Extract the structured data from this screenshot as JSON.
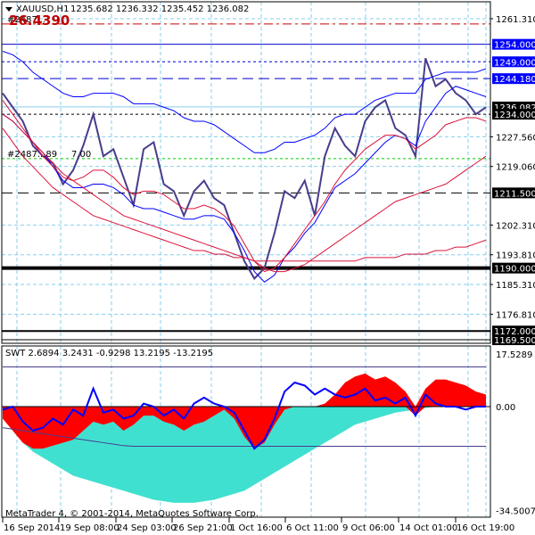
{
  "header": {
    "symbol": "XAUUSD,H1",
    "ohlc": "1235.682 1236.332 1235.452 1236.082",
    "object_label": "#2487...",
    "big_value": "26.4390",
    "obj_label2": "#2487...89",
    "obj_label2_value": "7.00"
  },
  "footer": {
    "copyright": "MetaTrader 4, © 2001-2014, MetaQuotes Software Corp."
  },
  "colors": {
    "price": "#483D8B",
    "band": "#0000FF",
    "ma": "#DC143C",
    "grid": "#87CEEB",
    "osc_pos": "#FF0000",
    "osc_neg": "#40E0D0",
    "osc_line": "#0000FF"
  },
  "chart_data": [
    {
      "type": "line",
      "title": "XAUUSD,H1",
      "ylim": [
        1166.8,
        1266
      ],
      "y_ticks": [
        "1261.310",
        "1227.560",
        "1219.060",
        "1202.310",
        "1193.810",
        "1185.310",
        "1176.810"
      ],
      "x_ticks": [
        "16 Sep 2014",
        "19 Sep 08:00",
        "24 Sep 03:00",
        "26 Sep 21:00",
        "1 Oct 16:00",
        "6 Oct 11:00",
        "9 Oct 06:00",
        "14 Oct 01:00",
        "16 Oct 19:00"
      ],
      "levels": [
        {
          "label": "1254.000",
          "value": 1254,
          "style": "solid",
          "color": "#0000CC",
          "box": "#0000FF"
        },
        {
          "label": "1249.000",
          "value": 1249,
          "style": "dash",
          "color": "#0000CC",
          "box": "#0000FF"
        },
        {
          "label": "1244.180",
          "value": 1244.18,
          "style": "longdash",
          "color": "#0000CC",
          "box": "#0000FF"
        },
        {
          "label": "1236.082",
          "value": 1236.082,
          "style": "bid",
          "color": "#87CEEB",
          "box": "#000000"
        },
        {
          "label": "1234.000",
          "value": 1234,
          "style": "dash",
          "color": "#000000",
          "box": "#000000"
        },
        {
          "label": "1211.500",
          "value": 1211.5,
          "style": "longdash",
          "color": "#000000",
          "box": "#000000"
        },
        {
          "label": "1190.000",
          "value": 1190,
          "style": "thick",
          "color": "#000000",
          "box": "#000000"
        },
        {
          "label": "1172.000",
          "value": 1172,
          "style": "medium",
          "color": "#000000",
          "box": "#000000"
        },
        {
          "label": "1169.500",
          "value": 1169.5,
          "style": "solid",
          "color": "#000000",
          "box": "#000000"
        },
        {
          "label": "",
          "value": 1259.8,
          "style": "dashdot",
          "color": "#CC0000",
          "box": ""
        },
        {
          "label": "",
          "value": 1221.3,
          "style": "dash",
          "color": "#00CC00",
          "box": ""
        }
      ],
      "series": [
        {
          "name": "close",
          "color": "#483D8B",
          "values": [
            1240,
            1236,
            1232,
            1225,
            1222,
            1220,
            1214,
            1218,
            1225,
            1234,
            1222,
            1224,
            1216,
            1208,
            1224,
            1226,
            1214,
            1212,
            1205,
            1212,
            1215,
            1210,
            1208,
            1200,
            1192,
            1187,
            1190,
            1200,
            1212,
            1210,
            1215,
            1205,
            1222,
            1230,
            1225,
            1222,
            1232,
            1236,
            1238,
            1230,
            1228,
            1222,
            1250,
            1242,
            1244,
            1240,
            1238,
            1234,
            1236
          ]
        },
        {
          "name": "upper-band",
          "color": "#0000FF",
          "values": [
            1252,
            1251,
            1249,
            1246,
            1244,
            1242,
            1240,
            1239,
            1239,
            1240,
            1240,
            1240,
            1239,
            1237,
            1237,
            1237,
            1236,
            1235,
            1233,
            1232,
            1232,
            1231,
            1229,
            1227,
            1225,
            1223,
            1223,
            1224,
            1226,
            1226,
            1227,
            1228,
            1230,
            1233,
            1234,
            1234,
            1236,
            1238,
            1239,
            1240,
            1240,
            1240,
            1244,
            1245,
            1246,
            1246,
            1246,
            1246,
            1247
          ]
        },
        {
          "name": "lower-band",
          "color": "#0000FF",
          "values": [
            1234,
            1232,
            1229,
            1226,
            1223,
            1219,
            1215,
            1213,
            1213,
            1214,
            1214,
            1213,
            1211,
            1208,
            1207,
            1207,
            1206,
            1205,
            1204,
            1204,
            1205,
            1205,
            1204,
            1200,
            1195,
            1189,
            1186,
            1188,
            1193,
            1196,
            1200,
            1203,
            1208,
            1213,
            1215,
            1217,
            1220,
            1223,
            1226,
            1228,
            1227,
            1225,
            1232,
            1236,
            1240,
            1242,
            1241,
            1240,
            1239
          ]
        },
        {
          "name": "ma-fast",
          "color": "#DC143C",
          "values": [
            1238,
            1234,
            1230,
            1226,
            1222,
            1219,
            1216,
            1215,
            1216,
            1218,
            1218,
            1216,
            1213,
            1211,
            1212,
            1212,
            1211,
            1209,
            1207,
            1207,
            1208,
            1207,
            1205,
            1202,
            1197,
            1192,
            1189,
            1190,
            1193,
            1197,
            1201,
            1205,
            1209,
            1214,
            1218,
            1221,
            1224,
            1226,
            1228,
            1228,
            1227,
            1224,
            1226,
            1228,
            1231,
            1232,
            1233,
            1233,
            1232
          ]
        },
        {
          "name": "ma-slow",
          "color": "#DC143C",
          "values": [
            1234,
            1232,
            1229,
            1226,
            1223,
            1220,
            1217,
            1215,
            1213,
            1211,
            1209,
            1207,
            1205,
            1204,
            1203,
            1202,
            1201,
            1200,
            1199,
            1198,
            1197,
            1196,
            1195,
            1194,
            1193,
            1192,
            1190,
            1189,
            1189,
            1190,
            1191,
            1193,
            1195,
            1197,
            1199,
            1201,
            1203,
            1205,
            1207,
            1209,
            1210,
            1211,
            1212,
            1213,
            1214,
            1216,
            1218,
            1220,
            1222
          ]
        },
        {
          "name": "ma-200",
          "color": "#DC143C",
          "values": [
            1230,
            1226,
            1222,
            1219,
            1216,
            1213,
            1211,
            1209,
            1207,
            1205,
            1204,
            1203,
            1202,
            1201,
            1200,
            1199,
            1198,
            1197,
            1196,
            1195,
            1195,
            1194,
            1194,
            1193,
            1193,
            1192,
            1192,
            1192,
            1192,
            1192,
            1192,
            1192,
            1192,
            1192,
            1192,
            1192,
            1193,
            1193,
            1193,
            1193,
            1194,
            1194,
            1194,
            1195,
            1195,
            1196,
            1196,
            1197,
            1198
          ]
        }
      ]
    },
    {
      "type": "area",
      "title": "SWT 2.6894 3.2431 -0.9298 13.2195 -13.2195",
      "ylim": [
        -34.5007,
        17.5289
      ],
      "y_ticks": [
        "17.5289",
        "0.00",
        "-34.5007"
      ],
      "series": [
        {
          "name": "fill-upper",
          "values": [
            0,
            0,
            0,
            0,
            0,
            0,
            0,
            0,
            0,
            0,
            0,
            0,
            0,
            0,
            0,
            0,
            0,
            0,
            0,
            0,
            0,
            0,
            0,
            0,
            0,
            0,
            0,
            0,
            0,
            0,
            0,
            0,
            1,
            4,
            8,
            10,
            11,
            9,
            10,
            8,
            5,
            0,
            6,
            9,
            9,
            8,
            7,
            5,
            4
          ]
        },
        {
          "name": "fill-lower",
          "values": [
            -4,
            -8,
            -12,
            -14,
            -14,
            -13,
            -12,
            -11,
            -8,
            -5,
            -6,
            -5,
            -8,
            -6,
            -3,
            -3,
            -5,
            -6,
            -8,
            -6,
            -5,
            -3,
            -1,
            -4,
            -10,
            -14,
            -12,
            -6,
            -1,
            0,
            0,
            0,
            0,
            0,
            0,
            0,
            0,
            0,
            0,
            0,
            0,
            -3,
            0,
            0,
            0,
            0,
            0,
            0,
            0
          ]
        },
        {
          "name": "cyan-area",
          "values": [
            -3,
            -8,
            -12,
            -15,
            -17,
            -19,
            -21,
            -23,
            -24,
            -25,
            -26,
            -27,
            -28,
            -29,
            -30,
            -31,
            -31.5,
            -32,
            -32,
            -32,
            -31.5,
            -31,
            -30,
            -29,
            -28,
            -26,
            -24,
            -22,
            -20,
            -18,
            -16,
            -14,
            -12,
            -10,
            -8,
            -6,
            -5,
            -4,
            -3,
            -2,
            -1.5,
            -1,
            -0.5,
            0,
            0,
            0,
            0,
            0,
            0
          ]
        },
        {
          "name": "swt-line",
          "values": [
            -1,
            0,
            -5,
            -8,
            -7,
            -4,
            -6,
            -1,
            -3,
            6,
            -2,
            -1,
            -4,
            -3,
            1,
            0,
            -3,
            -1,
            -4,
            1,
            3,
            1,
            0,
            -2,
            -8,
            -14,
            -11,
            -4,
            5,
            8,
            7,
            4,
            6,
            4,
            3,
            4,
            6,
            2,
            3,
            1,
            3,
            -3,
            4,
            1,
            0,
            0,
            -1,
            0,
            0
          ]
        },
        {
          "name": "upper-level",
          "values": [
            13.2,
            13.2,
            13.2,
            13.2,
            13.2,
            13.2,
            13.2,
            13.2,
            13.2,
            13.2,
            13.2,
            13.2,
            13.2,
            13.2,
            13.2,
            13.2,
            13.2,
            13.2,
            13.2,
            13.2,
            13.2,
            13.2,
            13.2,
            13.2,
            13.2,
            13.2,
            13.2,
            13.2,
            13.2,
            13.2,
            13.2,
            13.2,
            13.2,
            13.2,
            13.2,
            13.2,
            13.2,
            13.2,
            13.2,
            13.2,
            13.2,
            13.2,
            13.2,
            13.2,
            13.2,
            13.2,
            13.2,
            13.2,
            13.2
          ]
        },
        {
          "name": "lower-level",
          "values": [
            -7,
            -7.5,
            -8,
            -8.5,
            -9,
            -9.5,
            -10,
            -10.5,
            -11,
            -11.5,
            -12,
            -12.5,
            -13,
            -13.2,
            -13.2,
            -13.2,
            -13.2,
            -13.2,
            -13.2,
            -13.2,
            -13.2,
            -13.2,
            -13.2,
            -13.2,
            -13.2,
            -13.2,
            -13.2,
            -13.2,
            -13.2,
            -13.2,
            -13.2,
            -13.2,
            -13.2,
            -13.2,
            -13.2,
            -13.2,
            -13.2,
            -13.2,
            -13.2,
            -13.2,
            -13.2,
            -13.2,
            -13.2,
            -13.2,
            -13.2,
            -13.2,
            -13.2,
            -13.2,
            -13.2
          ]
        }
      ]
    }
  ]
}
